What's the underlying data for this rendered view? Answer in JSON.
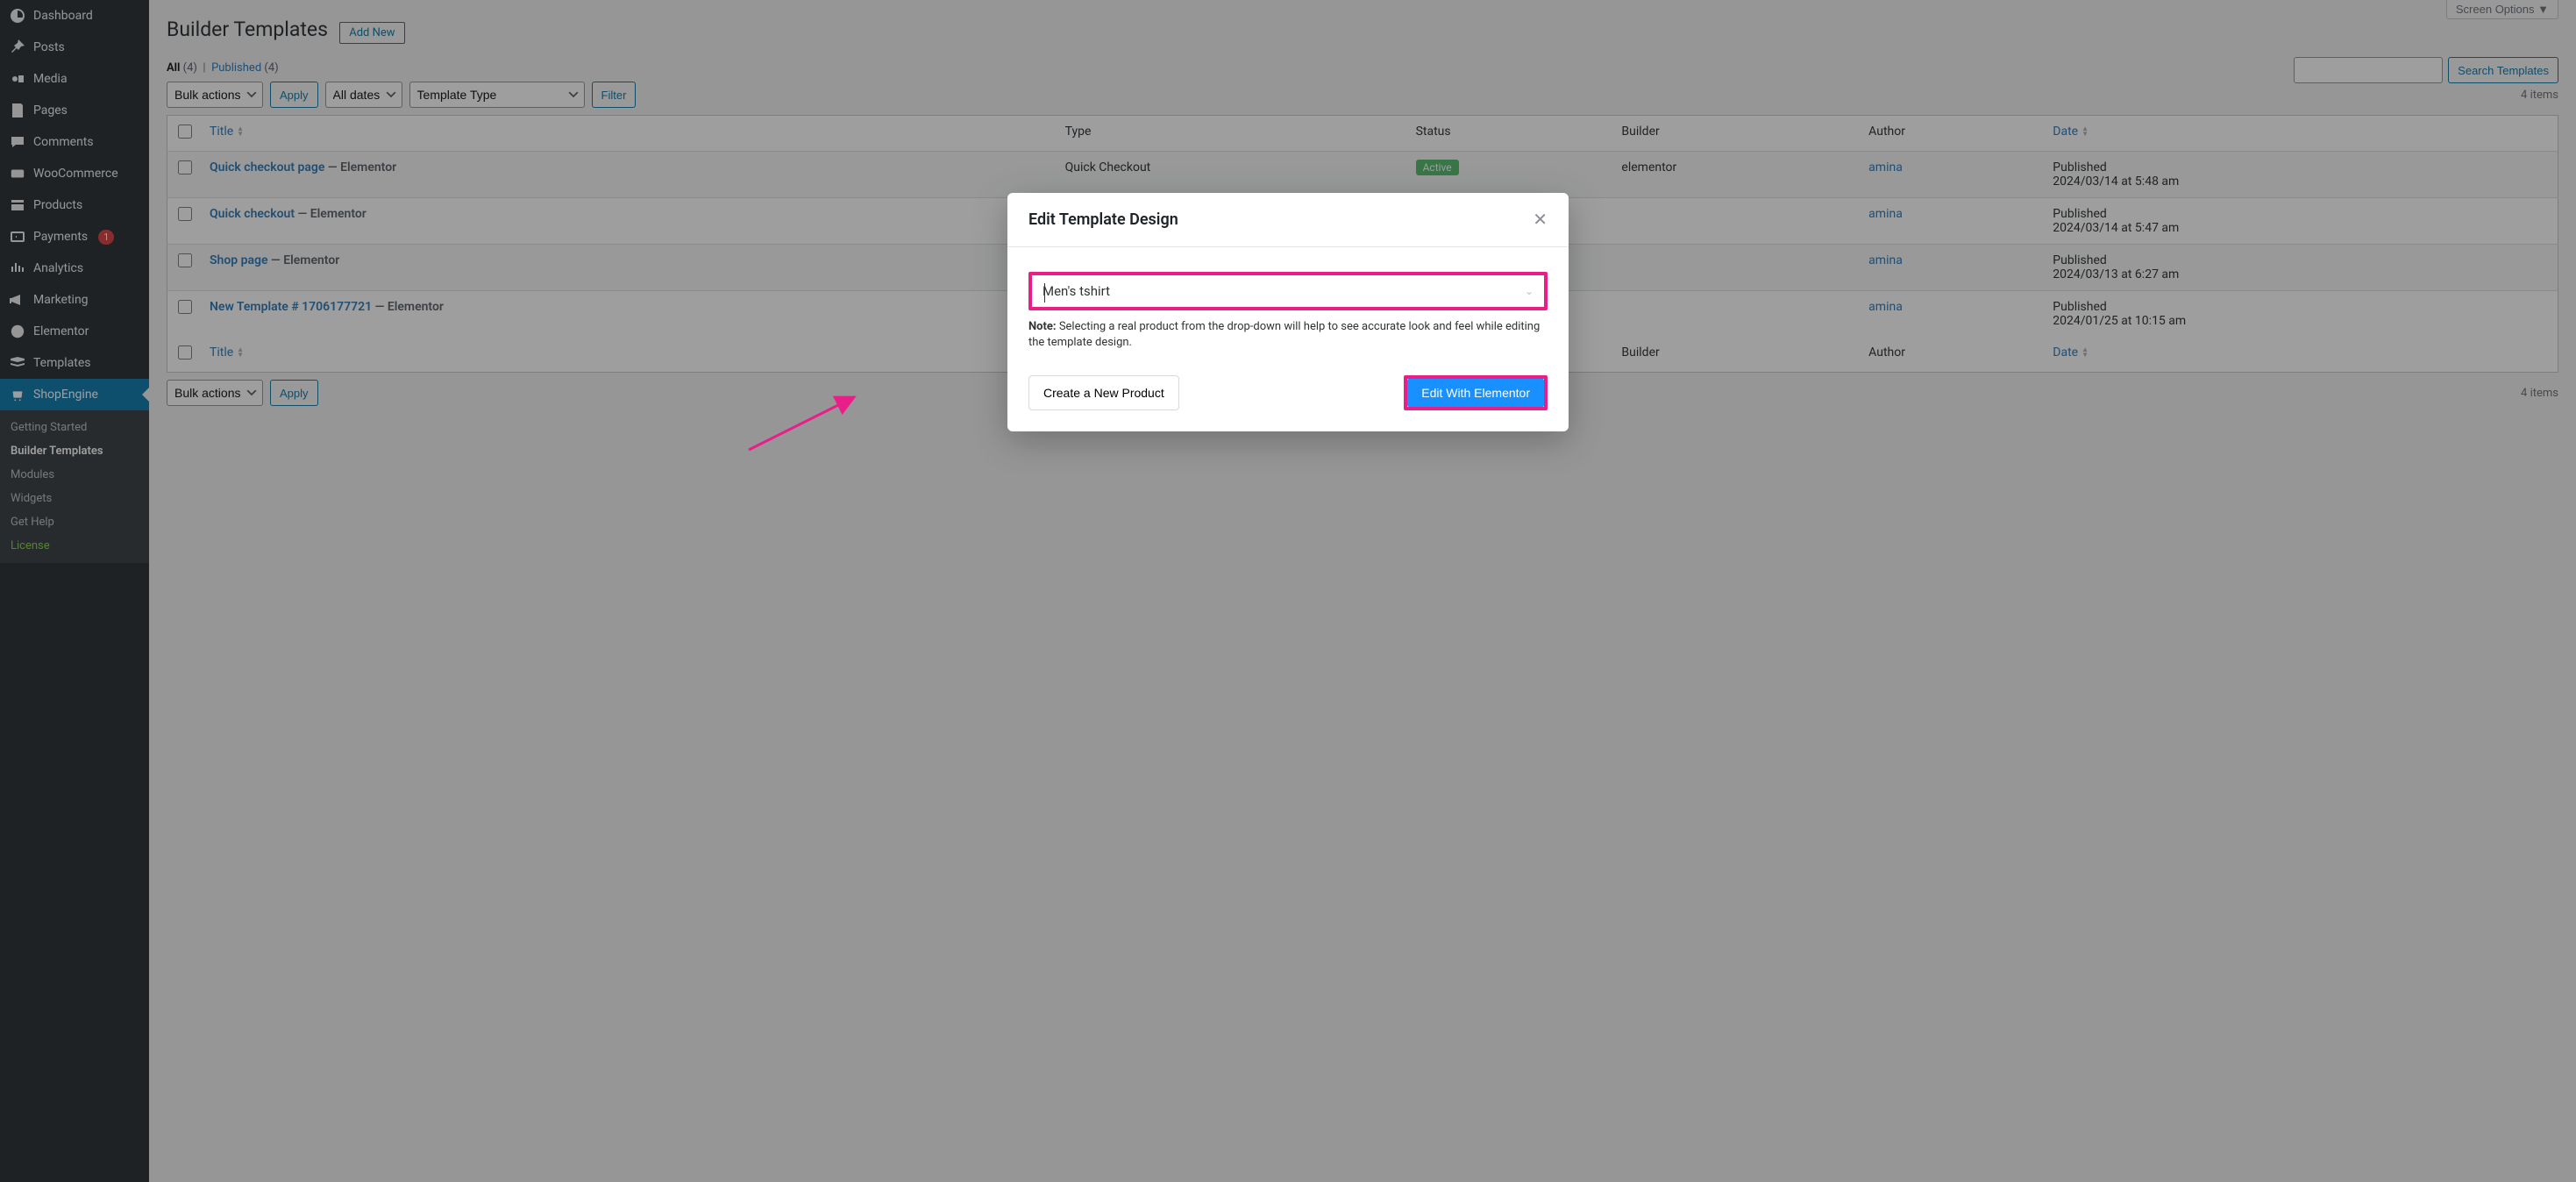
{
  "sidebar": {
    "items": [
      {
        "label": "Dashboard",
        "icon": "dashboard"
      },
      {
        "label": "Posts",
        "icon": "pin"
      },
      {
        "label": "Media",
        "icon": "media"
      },
      {
        "label": "Pages",
        "icon": "page"
      },
      {
        "label": "Comments",
        "icon": "comment"
      },
      {
        "label": "WooCommerce",
        "icon": "woo"
      },
      {
        "label": "Products",
        "icon": "products"
      },
      {
        "label": "Payments",
        "icon": "payments",
        "badge": "1"
      },
      {
        "label": "Analytics",
        "icon": "analytics"
      },
      {
        "label": "Marketing",
        "icon": "marketing"
      },
      {
        "label": "Elementor",
        "icon": "elementor"
      },
      {
        "label": "Templates",
        "icon": "templates"
      },
      {
        "label": "ShopEngine",
        "icon": "shopengine",
        "active": true
      }
    ],
    "submenu": [
      {
        "label": "Getting Started"
      },
      {
        "label": "Builder Templates",
        "current": true
      },
      {
        "label": "Modules"
      },
      {
        "label": "Widgets"
      },
      {
        "label": "Get Help"
      },
      {
        "label": "License",
        "license": true
      }
    ]
  },
  "header": {
    "screen_options": "Screen Options",
    "title": "Builder Templates",
    "add_new": "Add New"
  },
  "filters": {
    "all_label": "All",
    "all_count": "(4)",
    "sep": "|",
    "published_label": "Published",
    "published_count": "(4)",
    "bulk_actions": "Bulk actions",
    "apply": "Apply",
    "all_dates": "All dates",
    "template_type": "Template Type",
    "filter": "Filter",
    "items_count": "4 items",
    "search_btn": "Search Templates"
  },
  "columns": {
    "title": "Title",
    "type": "Type",
    "status": "Status",
    "builder": "Builder",
    "author": "Author",
    "date": "Date"
  },
  "rows": [
    {
      "title": "Quick checkout page",
      "suffix": " — Elementor",
      "type": "Quick Checkout",
      "status": "Active",
      "builder": "elementor",
      "author": "amina",
      "date_label": "Published",
      "date_value": "2024/03/14 at 5:48 am"
    },
    {
      "title": "Quick checkout",
      "suffix": " — Elementor",
      "type": "",
      "status": "",
      "builder": "",
      "author": "amina",
      "date_label": "Published",
      "date_value": "2024/03/14 at 5:47 am"
    },
    {
      "title": "Shop page",
      "suffix": " — Elementor",
      "type": "",
      "status": "",
      "builder": "",
      "author": "amina",
      "date_label": "Published",
      "date_value": "2024/03/13 at 6:27 am"
    },
    {
      "title": "New Template # 1706177721",
      "suffix": " — Elementor",
      "type": "",
      "status": "",
      "builder": "",
      "author": "amina",
      "date_label": "Published",
      "date_value": "2024/01/25 at 10:15 am"
    }
  ],
  "modal": {
    "title": "Edit Template Design",
    "product_value": "Men's tshirt",
    "note_label": "Note:",
    "note_text": " Selecting a real product from the drop-down will help to see accurate look and feel while editing the template design.",
    "create_btn": "Create a New Product",
    "edit_btn": "Edit With Elementor"
  },
  "colors": {
    "highlight": "#E91E89",
    "primary": "#1890ff"
  }
}
